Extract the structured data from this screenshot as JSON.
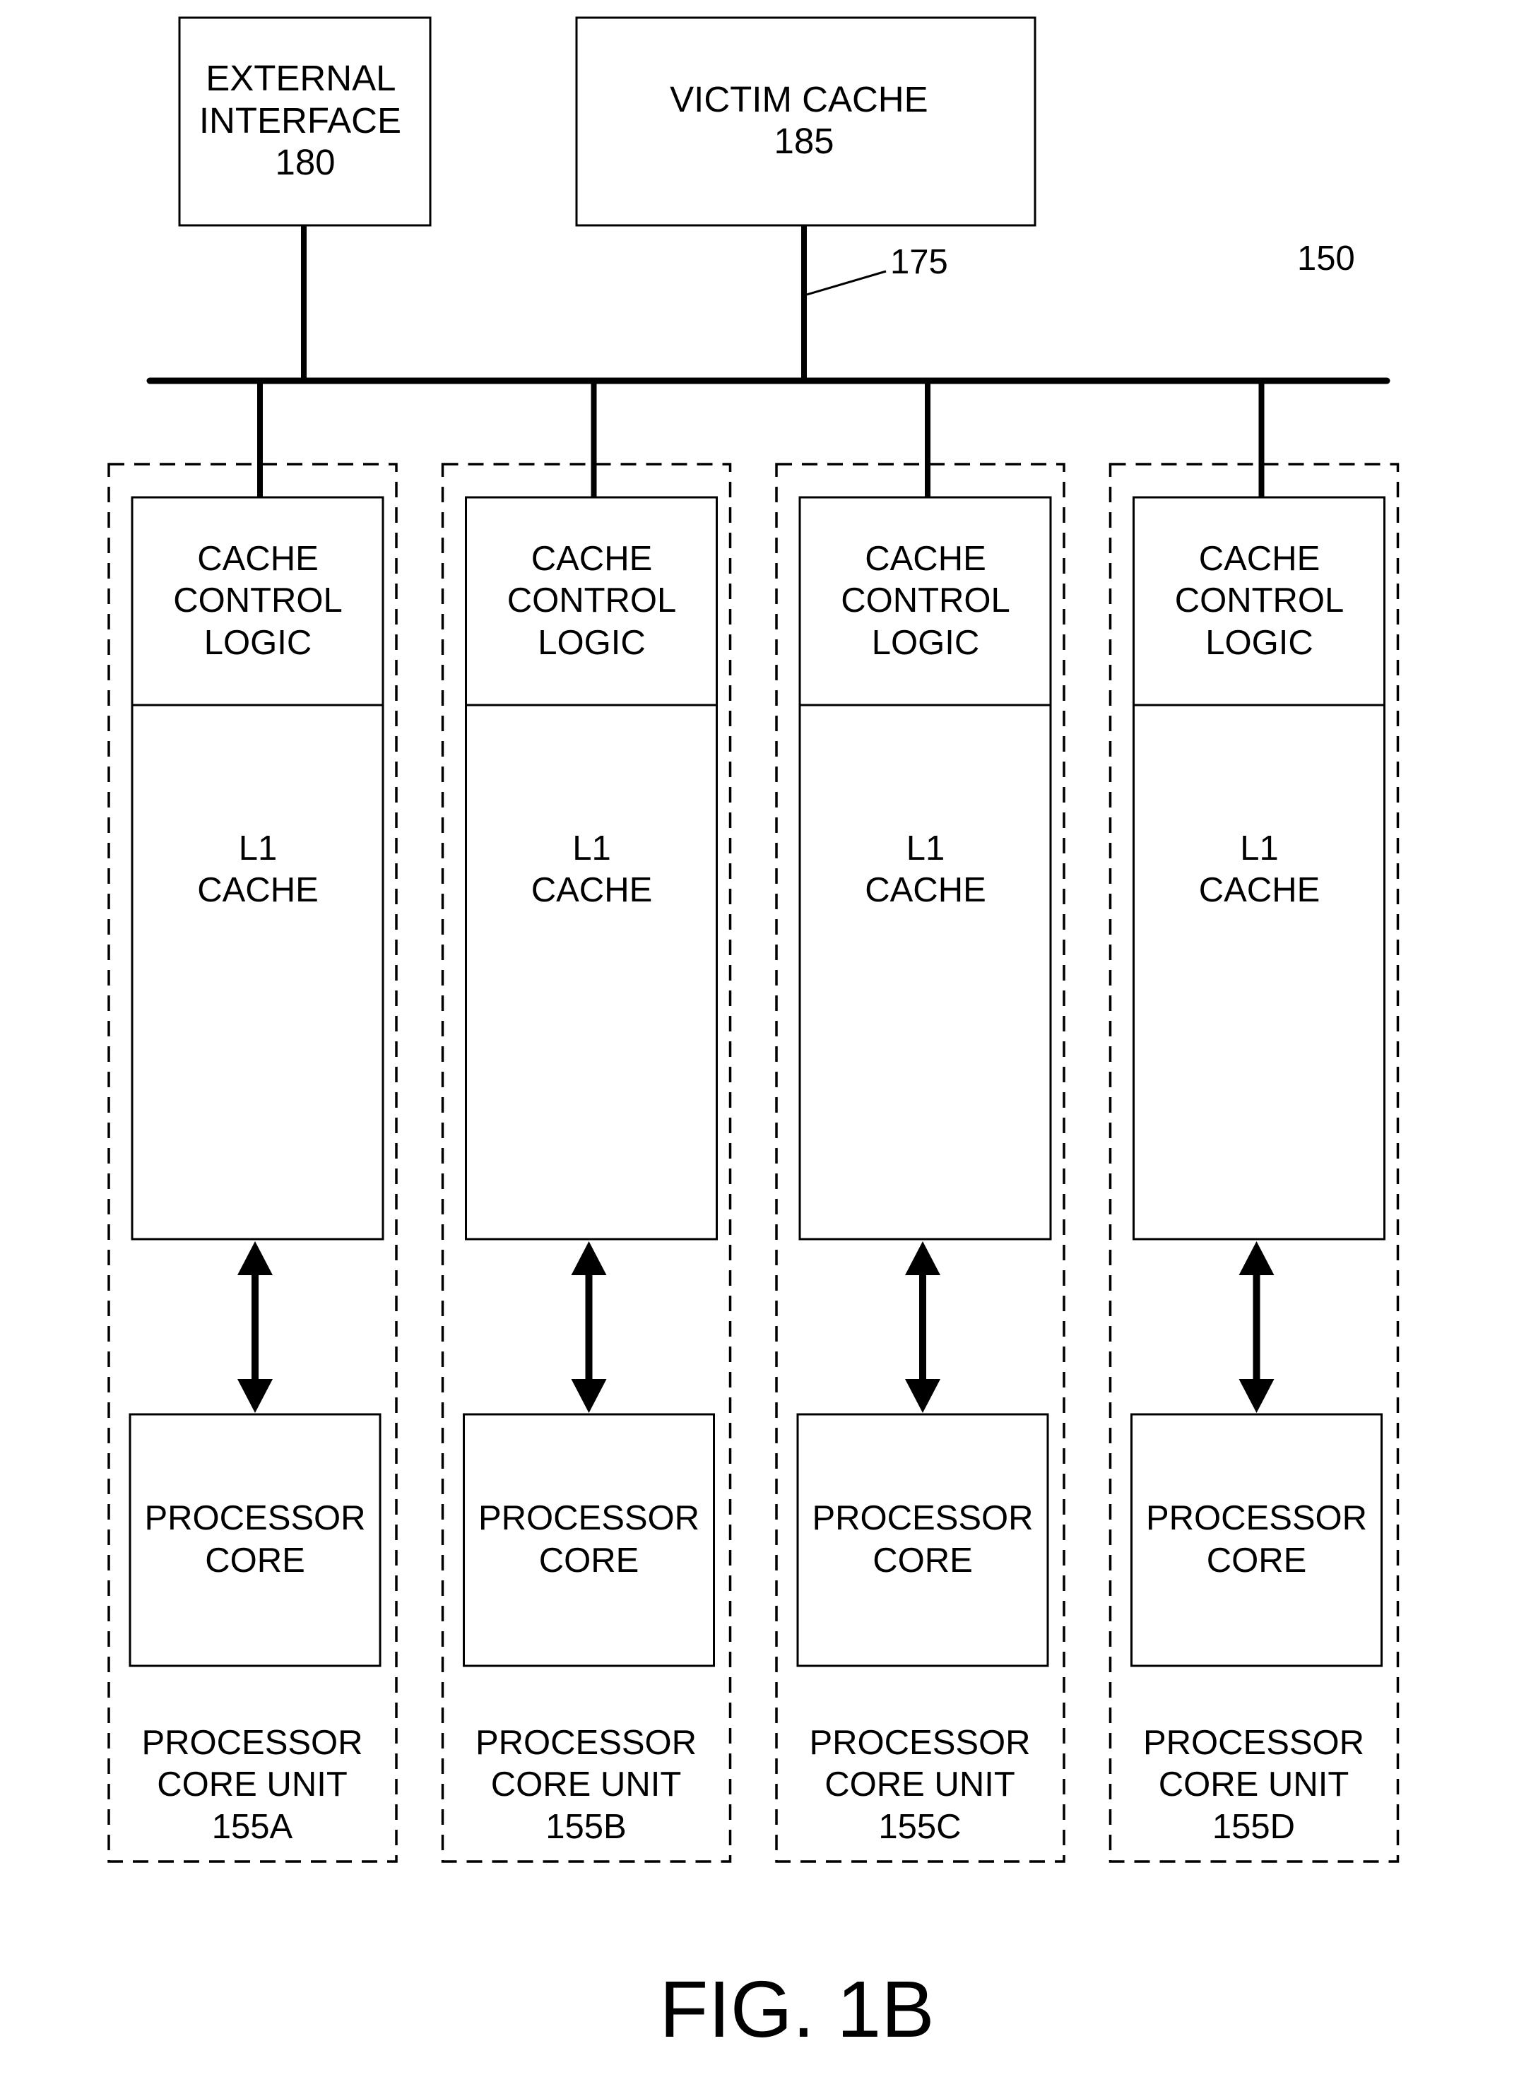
{
  "figure": {
    "label": "FIG. 1B",
    "system_ref": "150",
    "bus_ref": "175"
  },
  "external_interface": {
    "lines": [
      "EXTERNAL",
      "INTERFACE",
      "180"
    ]
  },
  "victim_cache": {
    "lines": [
      "VICTIM CACHE",
      "185"
    ]
  },
  "units": [
    {
      "id": "155A",
      "cache_control": [
        "CACHE",
        "CONTROL",
        "LOGIC"
      ],
      "l1_cache": [
        "L1",
        "CACHE"
      ],
      "processor_core": [
        "PROCESSOR",
        "CORE"
      ],
      "unit_label": [
        "PROCESSOR",
        "CORE UNIT",
        "155A"
      ]
    },
    {
      "id": "155B",
      "cache_control": [
        "CACHE",
        "CONTROL",
        "LOGIC"
      ],
      "l1_cache": [
        "L1",
        "CACHE"
      ],
      "processor_core": [
        "PROCESSOR",
        "CORE"
      ],
      "unit_label": [
        "PROCESSOR",
        "CORE UNIT",
        "155B"
      ]
    },
    {
      "id": "155C",
      "cache_control": [
        "CACHE",
        "CONTROL",
        "LOGIC"
      ],
      "l1_cache": [
        "L1",
        "CACHE"
      ],
      "processor_core": [
        "PROCESSOR",
        "CORE"
      ],
      "unit_label": [
        "PROCESSOR",
        "CORE UNIT",
        "155C"
      ]
    },
    {
      "id": "155D",
      "cache_control": [
        "CACHE",
        "CONTROL",
        "LOGIC"
      ],
      "l1_cache": [
        "L1",
        "CACHE"
      ],
      "processor_core": [
        "PROCESSOR",
        "CORE"
      ],
      "unit_label": [
        "PROCESSOR",
        "CORE UNIT",
        "155D"
      ]
    }
  ]
}
